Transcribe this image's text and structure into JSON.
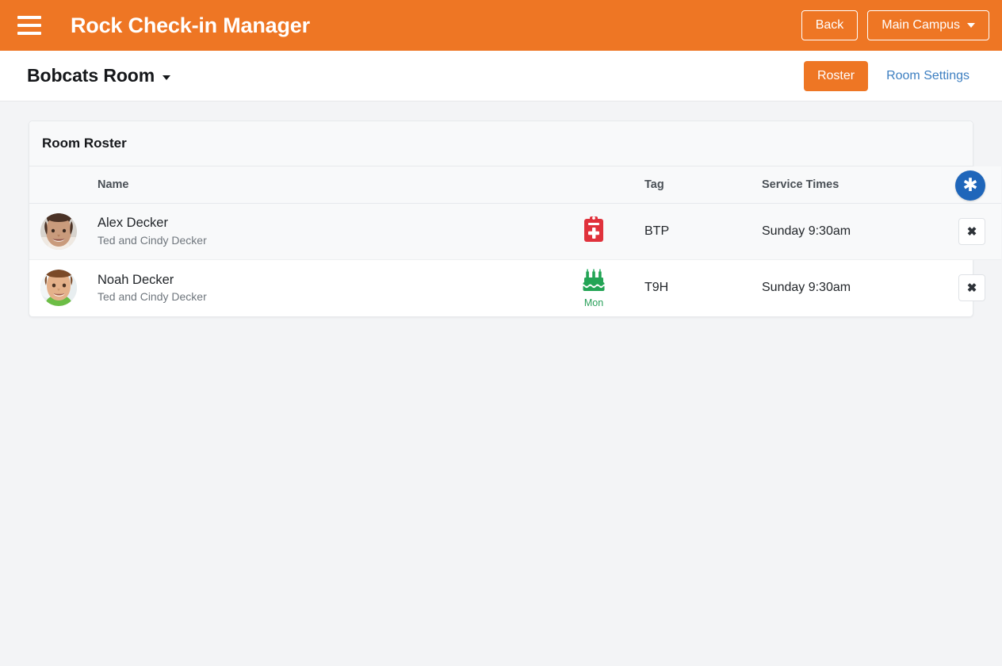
{
  "topbar": {
    "menu_icon": "hamburger-menu-icon",
    "app_title": "Rock Check-in Manager",
    "back_label": "Back",
    "campus_label": "Main Campus",
    "campus_caret_icon": "caret-down-icon",
    "background_color": "#ee7624"
  },
  "subbar": {
    "room_name": "Bobcats Room",
    "room_caret_icon": "caret-down-icon",
    "tabs": [
      {
        "label": "Roster",
        "active": true
      },
      {
        "label": "Room Settings",
        "active": false
      }
    ],
    "active_tab_color": "#ee7624",
    "link_color": "#3d7fc1"
  },
  "card": {
    "title": "Room Roster",
    "columns": [
      "",
      "Name",
      "",
      "Tag",
      "Service Times",
      ""
    ],
    "rows": [
      {
        "avatar_icon": "girl-photo-avatar",
        "name": "Alex Decker",
        "parents": "Ted and Cindy Decker",
        "icon": "medical-clipboard-icon",
        "icon_color": "#e0323c",
        "icon_caption": "",
        "tag": "BTP",
        "service_times": "Sunday 9:30am",
        "remove_label": "✖"
      },
      {
        "avatar_icon": "boy-photo-avatar",
        "name": "Noah Decker",
        "parents": "Ted and Cindy Decker",
        "icon": "birthday-cake-icon",
        "icon_color": "#23a455",
        "icon_caption": "Mon",
        "tag": "T9H",
        "service_times": "Sunday 9:30am",
        "remove_label": "✖"
      }
    ]
  },
  "fab": {
    "icon": "asterisk-icon",
    "glyph": "✱",
    "color": "#1f66ba"
  }
}
